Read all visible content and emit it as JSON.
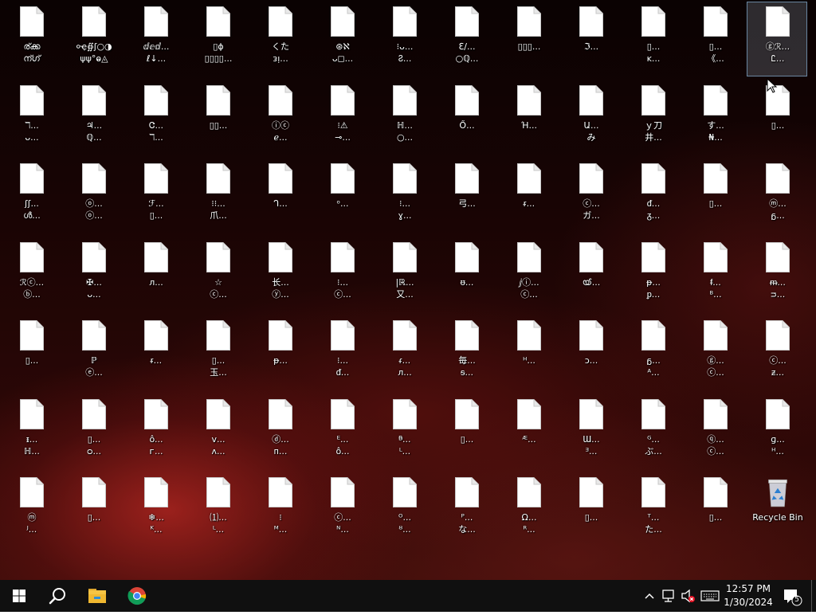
{
  "desktop": {
    "icons": [
      {
        "line1": "ര്ക്ക",
        "line2": "ന്ഗ്",
        "selected": false
      },
      {
        "line1": "०ҿ∯ʃ○◑",
        "line2": "ψψ°ⱺ◬",
        "selected": false
      },
      {
        "line1": "ⅆⅇⅆ...",
        "line2": "ℓ↓...",
        "selected": false
      },
      {
        "line1": "▯ɸ",
        "line2": "▯▯▯▯...",
        "selected": false
      },
      {
        "line1": "くた",
        "line2": "ᴈᴉ...",
        "selected": false
      },
      {
        "line1": "⊛ℵ",
        "line2": "ᴗ◻...",
        "selected": false
      },
      {
        "line1": "⁝ᴗ...",
        "line2": "Ⴧ...",
        "selected": false
      },
      {
        "line1": "ℇ∕...",
        "line2": "○ℚ...",
        "selected": false
      },
      {
        "line1": "▯▯▯...",
        "line2": "",
        "selected": false
      },
      {
        "line1": "ℑ...",
        "line2": "",
        "selected": false
      },
      {
        "line1": "▯...",
        "line2": "ᴋ...",
        "selected": false
      },
      {
        "line1": "▯...",
        "line2": "《...",
        "selected": false
      },
      {
        "line1": "ⓖℛ...",
        "line2": "Ꮭ...",
        "selected": true
      },
      {
        "line1": "ℸ...",
        "line2": "ᴗ...",
        "selected": false
      },
      {
        "line1": "♃...",
        "line2": "ℚ...",
        "selected": false
      },
      {
        "line1": "Ꮳ...",
        "line2": "ℸ...",
        "selected": false
      },
      {
        "line1": "▯▯...",
        "line2": "",
        "selected": false
      },
      {
        "line1": "ⓘⓒ",
        "line2": "ℯ...",
        "selected": false
      },
      {
        "line1": "⁝⚠",
        "line2": "⊸...",
        "selected": false
      },
      {
        "line1": "ℍ...",
        "line2": "○...",
        "selected": false
      },
      {
        "line1": "Ő...",
        "line2": "",
        "selected": false
      },
      {
        "line1": "Ή...",
        "line2": "",
        "selected": false
      },
      {
        "line1": "Ա...",
        "line2": "み",
        "selected": false
      },
      {
        "line1": "ｙ刀",
        "line2": "井...",
        "selected": false
      },
      {
        "line1": "す...",
        "line2": "₦...",
        "selected": false
      },
      {
        "line1": "▯...",
        "line2": "",
        "selected": false
      },
      {
        "line1": "ʃʃ...",
        "line2": "ൾ...",
        "selected": false
      },
      {
        "line1": "ⓞ...",
        "line2": "ⓞ...",
        "selected": false
      },
      {
        "line1": "ℱ...",
        "line2": "▯...",
        "selected": false
      },
      {
        "line1": "⁝⁝...",
        "line2": "爪...",
        "selected": false
      },
      {
        "line1": "ᒉ...",
        "line2": "",
        "selected": false
      },
      {
        "line1": "ᵒ...",
        "line2": "",
        "selected": false
      },
      {
        "line1": "⁝...",
        "line2": "ɣ...",
        "selected": false
      },
      {
        "line1": "弓...",
        "line2": "",
        "selected": false
      },
      {
        "line1": "ᵲ...",
        "line2": "",
        "selected": false
      },
      {
        "line1": "ⓒ...",
        "line2": "ガ...",
        "selected": false
      },
      {
        "line1": "ᵭ...",
        "line2": "ᵹ...",
        "selected": false
      },
      {
        "line1": "▯...",
        "line2": "",
        "selected": false
      },
      {
        "line1": "ⓜ...",
        "line2": "ᵷ...",
        "selected": false
      },
      {
        "line1": "ℛⓒ...",
        "line2": "ⓑ...",
        "selected": false
      },
      {
        "line1": "✠...",
        "line2": "ᴗ...",
        "selected": false
      },
      {
        "line1": "ᴫ...",
        "line2": "",
        "selected": false
      },
      {
        "line1": "☆",
        "line2": "ⓒ...",
        "selected": false
      },
      {
        "line1": "长...",
        "line2": "ⓨ...",
        "selected": false
      },
      {
        "line1": "⁝...",
        "line2": "ⓒ...",
        "selected": false
      },
      {
        "line1": "|ℝ...",
        "line2": "又...",
        "selected": false
      },
      {
        "line1": "ᵿ...",
        "line2": "",
        "selected": false
      },
      {
        "line1": "ⅉⓘ...",
        "line2": "ⓒ...",
        "selected": false
      },
      {
        "line1": "ൕ...",
        "line2": "",
        "selected": false
      },
      {
        "line1": "ᵽ...",
        "line2": "ᵱ...",
        "selected": false
      },
      {
        "line1": "ᵮ...",
        "line2": "ᴮ...",
        "selected": false
      },
      {
        "line1": "ᵯ...",
        "line2": "ᴝ...",
        "selected": false
      },
      {
        "line1": "▯...",
        "line2": "",
        "selected": false
      },
      {
        "line1": "ℙ",
        "line2": "ⓔ...",
        "selected": false
      },
      {
        "line1": "ᵲ...",
        "line2": "",
        "selected": false
      },
      {
        "line1": "▯...",
        "line2": "玉...",
        "selected": false
      },
      {
        "line1": "ᵽ...",
        "line2": "",
        "selected": false
      },
      {
        "line1": "⁝...",
        "line2": "ᵭ...",
        "selected": false
      },
      {
        "line1": "ᵳ...",
        "line2": "ᴫ...",
        "selected": false
      },
      {
        "line1": "毎...",
        "line2": "ᵴ...",
        "selected": false
      },
      {
        "line1": "ᵸ...",
        "line2": "",
        "selected": false
      },
      {
        "line1": "ɔ...",
        "line2": "",
        "selected": false
      },
      {
        "line1": "ᵷ...",
        "line2": "ᴬ...",
        "selected": false
      },
      {
        "line1": "ⓖ...",
        "line2": "ⓒ...",
        "selected": false
      },
      {
        "line1": "ⓒ...",
        "line2": "ᵶ...",
        "selected": false
      },
      {
        "line1": "ᵻ...",
        "line2": "ℍ...",
        "selected": false
      },
      {
        "line1": "▯...",
        "line2": "ᴑ...",
        "selected": false
      },
      {
        "line1": "ô...",
        "line2": "ᴦ...",
        "selected": false
      },
      {
        "line1": "ᴠ...",
        "line2": "ᴧ...",
        "selected": false
      },
      {
        "line1": "ⓓ...",
        "line2": "ᴨ...",
        "selected": false
      },
      {
        "line1": "ᴱ...",
        "line2": "ô...",
        "selected": false
      },
      {
        "line1": "ᴯ...",
        "line2": "ᴸ...",
        "selected": false
      },
      {
        "line1": "▯...",
        "line2": "",
        "selected": false
      },
      {
        "line1": "ᴭ...",
        "line2": "",
        "selected": false
      },
      {
        "line1": "Ɯ...",
        "line2": "ᴲ...",
        "selected": false
      },
      {
        "line1": "ᴳ...",
        "line2": "ぶ...",
        "selected": false
      },
      {
        "line1": "ⓠ...",
        "line2": "ⓒ...",
        "selected": false
      },
      {
        "line1": "ɡ...",
        "line2": "ᴴ...",
        "selected": false
      },
      {
        "line1": "ⓜ",
        "line2": "ᴶ...",
        "selected": false
      },
      {
        "line1": "▯...",
        "line2": "",
        "selected": false
      },
      {
        "line1": "❄...",
        "line2": "ᴷ...",
        "selected": false
      },
      {
        "line1": "⑴...",
        "line2": "ᴸ...",
        "selected": false
      },
      {
        "line1": "⁝",
        "line2": "ᴹ...",
        "selected": false
      },
      {
        "line1": "ⓒ...",
        "line2": "ᴺ...",
        "selected": false
      },
      {
        "line1": "ᴼ...",
        "line2": "ᴽ...",
        "selected": false
      },
      {
        "line1": "ᴾ...",
        "line2": "な...",
        "selected": false
      },
      {
        "line1": "Ω...",
        "line2": "ᴿ...",
        "selected": false
      },
      {
        "line1": "▯...",
        "line2": "",
        "selected": false
      },
      {
        "line1": "ᵀ...",
        "line2": "た...",
        "selected": false
      },
      {
        "line1": "▯...",
        "line2": "",
        "selected": false
      },
      {
        "line1": "Recycle Bin",
        "line2": "",
        "selected": false,
        "recycle": true
      }
    ]
  },
  "taskbar": {
    "start_icon": "windows-logo-icon",
    "search_icon": "search-icon",
    "pinned": [
      {
        "name": "file-explorer-icon"
      },
      {
        "name": "chrome-icon"
      }
    ],
    "tray": {
      "time": "12:57 PM",
      "date": "1/30/2024",
      "notification_count": "5"
    }
  }
}
